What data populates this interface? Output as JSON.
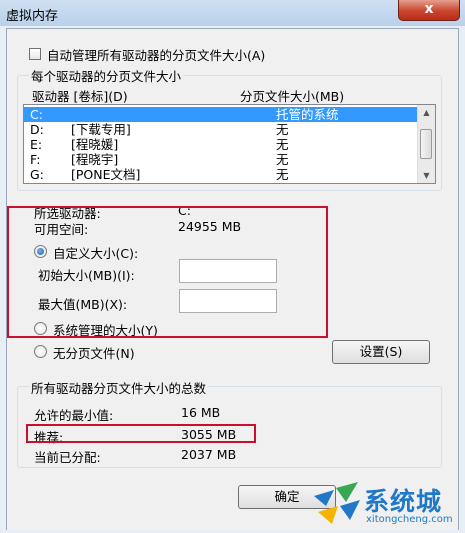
{
  "window": {
    "title": "虚拟内存",
    "close_label": "x"
  },
  "auto_manage": {
    "label": "自动管理所有驱动器的分页文件大小(A)",
    "checked": false
  },
  "per_drive": {
    "group_title": "每个驱动器的分页文件大小",
    "columns": {
      "drive": "驱动器 [卷标](D)",
      "size": "分页文件大小(MB)"
    },
    "rows": [
      {
        "drive": "C:",
        "label": "",
        "size": "托管的系统",
        "selected": true
      },
      {
        "drive": "D:",
        "label": "[下载专用]",
        "size": "无",
        "selected": false
      },
      {
        "drive": "E:",
        "label": "[程晓媛]",
        "size": "无",
        "selected": false
      },
      {
        "drive": "F:",
        "label": "[程晓宇]",
        "size": "无",
        "selected": false
      },
      {
        "drive": "G:",
        "label": "[PONE文档]",
        "size": "无",
        "selected": false
      }
    ]
  },
  "selected_drive": {
    "label": "所选驱动器:",
    "value": "C:"
  },
  "free_space": {
    "label": "可用空间:",
    "value": "24955 MB"
  },
  "custom_size": {
    "label": "自定义大小(C):",
    "selected": true
  },
  "initial_size": {
    "label": "初始大小(MB)(I):",
    "value": ""
  },
  "max_size": {
    "label": "最大值(MB)(X):",
    "value": ""
  },
  "system_managed": {
    "label": "系统管理的大小(Y)",
    "selected": false
  },
  "no_paging": {
    "label": "无分页文件(N)",
    "selected": false
  },
  "set_button": "设置(S)",
  "totals": {
    "group_title": "所有驱动器分页文件大小的总数",
    "min_allowed": {
      "label": "允许的最小值:",
      "value": "16 MB"
    },
    "recommended": {
      "label": "推荐:",
      "value": "3055 MB"
    },
    "allocated": {
      "label": "当前已分配:",
      "value": "2037 MB"
    }
  },
  "ok_button": "确定",
  "watermark": {
    "text": "系统城",
    "url": "xitongcheng.com"
  },
  "colors": {
    "highlight": "#3399ff",
    "annotation_red": "#c8102e",
    "titlebar": "#b9d1ea"
  }
}
